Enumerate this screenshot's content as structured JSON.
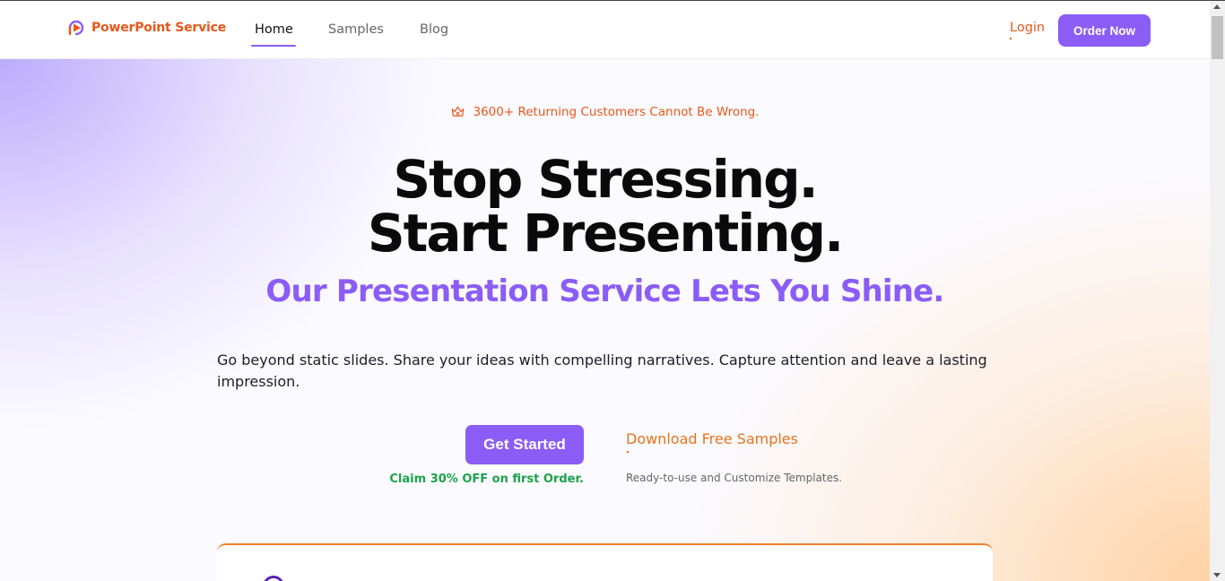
{
  "nav": {
    "brand": "PowerPoint Service",
    "links": [
      {
        "label": "Home",
        "active": true
      },
      {
        "label": "Samples",
        "active": false
      },
      {
        "label": "Blog",
        "active": false
      }
    ],
    "login": "Login",
    "order_button": "Order Now"
  },
  "hero": {
    "badge": "3600+ Returning Customers Cannot Be Wrong.",
    "headline_1": "Stop Stressing.",
    "headline_2": "Start Presenting.",
    "subheadline": "Our Presentation Service Lets You Shine.",
    "description": "Go beyond static slides. Share your ideas with compelling narratives. Capture attention and leave a lasting impression.",
    "cta_button": "Get Started",
    "cta_note": "Claim 30% OFF on first Order.",
    "download_link": "Download Free Samples",
    "download_note": "Ready-to-use and Customize Templates."
  },
  "colors": {
    "brand_orange": "#e8571b",
    "accent_purple": "#8b5cf6",
    "success_green": "#1aa34a"
  },
  "icons": {
    "brand": "play-logo-icon",
    "badge": "crown-icon"
  }
}
